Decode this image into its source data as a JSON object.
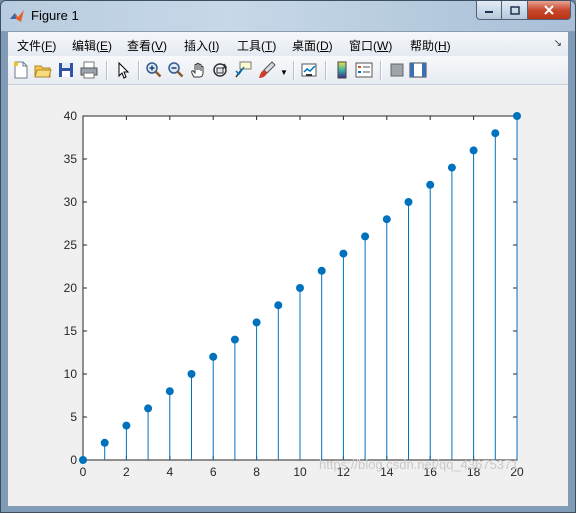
{
  "window": {
    "title": "Figure 1"
  },
  "menu": [
    {
      "label": "文件(",
      "key": "F",
      "tail": ")"
    },
    {
      "label": "编辑(",
      "key": "E",
      "tail": ")"
    },
    {
      "label": "查看(",
      "key": "V",
      "tail": ")"
    },
    {
      "label": "插入(",
      "key": "I",
      "tail": ")"
    },
    {
      "label": "工具(",
      "key": "T",
      "tail": ")"
    },
    {
      "label": "桌面(",
      "key": "D",
      "tail": ")"
    },
    {
      "label": "窗口(",
      "key": "W",
      "tail": ")"
    },
    {
      "label": "帮助(",
      "key": "H",
      "tail": ")"
    }
  ],
  "toolbar_icons": [
    "new-figure-icon",
    "open-file-icon",
    "save-icon",
    "print-icon",
    "pointer-icon",
    "zoom-in-icon",
    "zoom-out-icon",
    "pan-hand-icon",
    "rotate-3d-icon",
    "data-cursor-icon",
    "brush-icon",
    "link-plot-icon",
    "colorbar-icon",
    "legend-icon",
    "hide-plot-tools-icon",
    "show-plot-tools-icon"
  ],
  "watermark": "https://blog.csdn.net/qq_43675371",
  "chart_data": {
    "type": "stem",
    "x": [
      0,
      1,
      2,
      3,
      4,
      5,
      6,
      7,
      8,
      9,
      10,
      11,
      12,
      13,
      14,
      15,
      16,
      17,
      18,
      19,
      20
    ],
    "y": [
      0,
      2,
      4,
      6,
      8,
      10,
      12,
      14,
      16,
      18,
      20,
      22,
      24,
      26,
      28,
      30,
      32,
      34,
      36,
      38,
      40
    ],
    "xlim": [
      0,
      20
    ],
    "ylim": [
      0,
      40
    ],
    "xticks": [
      0,
      2,
      4,
      6,
      8,
      10,
      12,
      14,
      16,
      18,
      20
    ],
    "yticks": [
      0,
      5,
      10,
      15,
      20,
      25,
      30,
      35,
      40
    ],
    "color": "#0072BD",
    "grid": false
  }
}
